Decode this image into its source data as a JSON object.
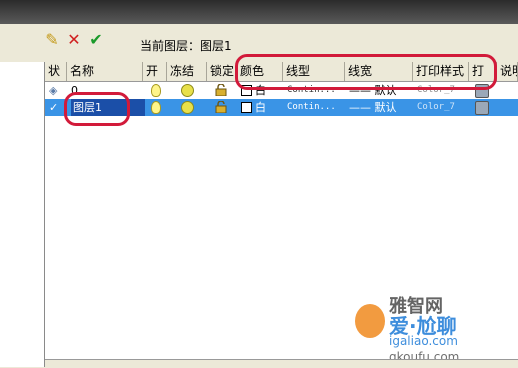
{
  "toolbar": {
    "current_layer_label": "当前图层：图层1",
    "icons": [
      "new-layer-icon",
      "delete-icon",
      "set-current-icon"
    ]
  },
  "columns": [
    "状",
    "名称",
    "开",
    "冻结",
    "锁定",
    "颜色",
    "线型",
    "线宽",
    "打印样式",
    "打",
    "说明"
  ],
  "layers": [
    {
      "status": "◈",
      "name": "0",
      "color": "白",
      "linetype": "Contin...",
      "lineweight": "—— 默认",
      "plot_style": "Color_7"
    },
    {
      "status": "✓",
      "name": "图层1",
      "color": "白",
      "linetype": "Contin...",
      "lineweight": "—— 默认",
      "plot_style": "Color_7"
    }
  ],
  "watermark": {
    "top": "雅智网",
    "cn": "爱·尬聊",
    "url": "igaliao.com",
    "sub": "qkoufu.com"
  },
  "colors": {
    "selection": "#3a94e6",
    "annotation": "#d21a3a"
  }
}
